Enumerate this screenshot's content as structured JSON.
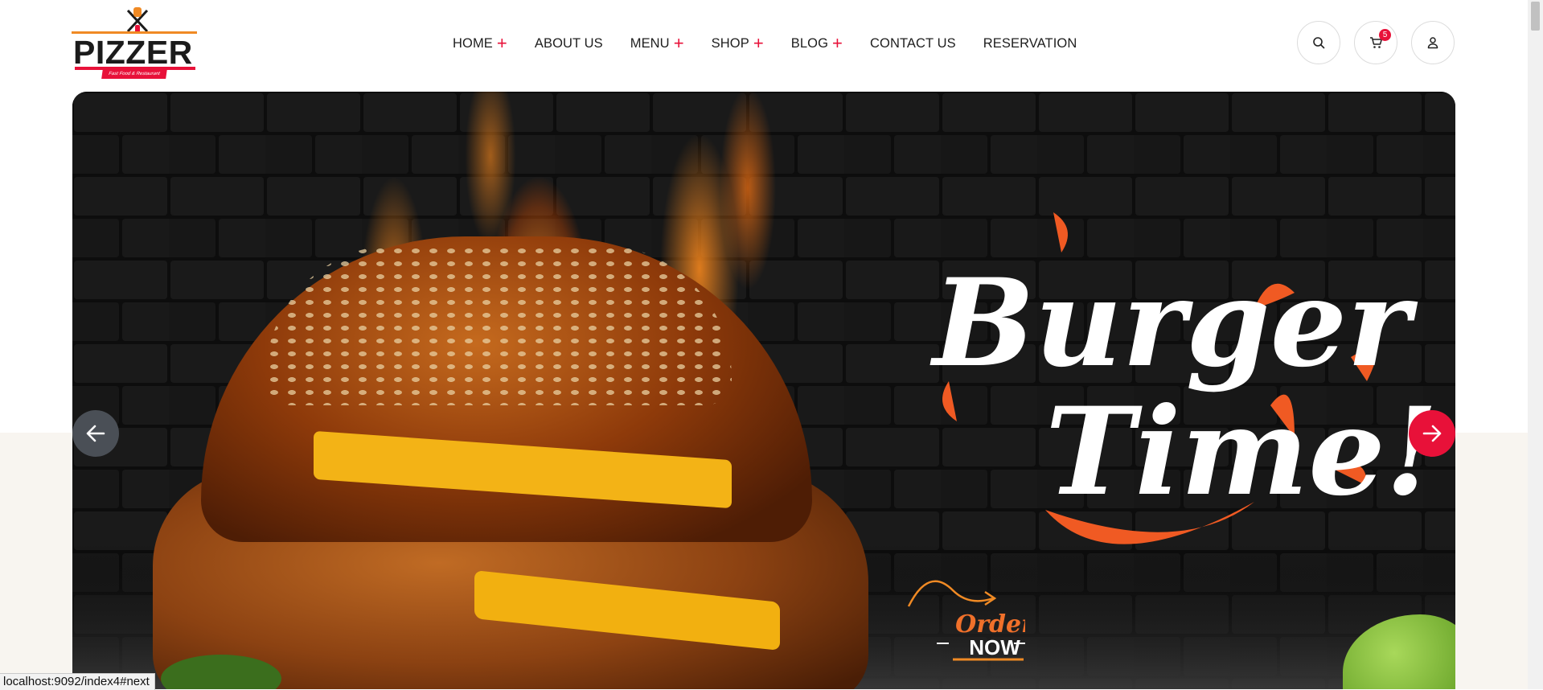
{
  "brand": {
    "name": "PIZZER",
    "tagline": "Fast Food & Restaurant",
    "accent_color": "#e81139",
    "secondary_color": "#f08a24"
  },
  "nav": {
    "items": [
      {
        "label": "HOME",
        "has_submenu": true
      },
      {
        "label": "ABOUT US",
        "has_submenu": false
      },
      {
        "label": "MENU",
        "has_submenu": true
      },
      {
        "label": "SHOP",
        "has_submenu": true
      },
      {
        "label": "BLOG",
        "has_submenu": true
      },
      {
        "label": "CONTACT US",
        "has_submenu": false
      },
      {
        "label": "RESERVATION",
        "has_submenu": false
      }
    ],
    "plus_symbol": "+"
  },
  "header_actions": {
    "search_icon": "search-icon",
    "cart_icon": "cart-icon",
    "cart_count": "5",
    "user_icon": "user-icon"
  },
  "hero": {
    "headline_line1": "Burger",
    "headline_line2": "Time!!",
    "cta_top": "Order",
    "cta_bottom": "NOW",
    "prev_icon": "arrow-left-icon",
    "next_icon": "arrow-right-icon"
  },
  "status_bar": {
    "url": "localhost:9092/index4#next"
  }
}
